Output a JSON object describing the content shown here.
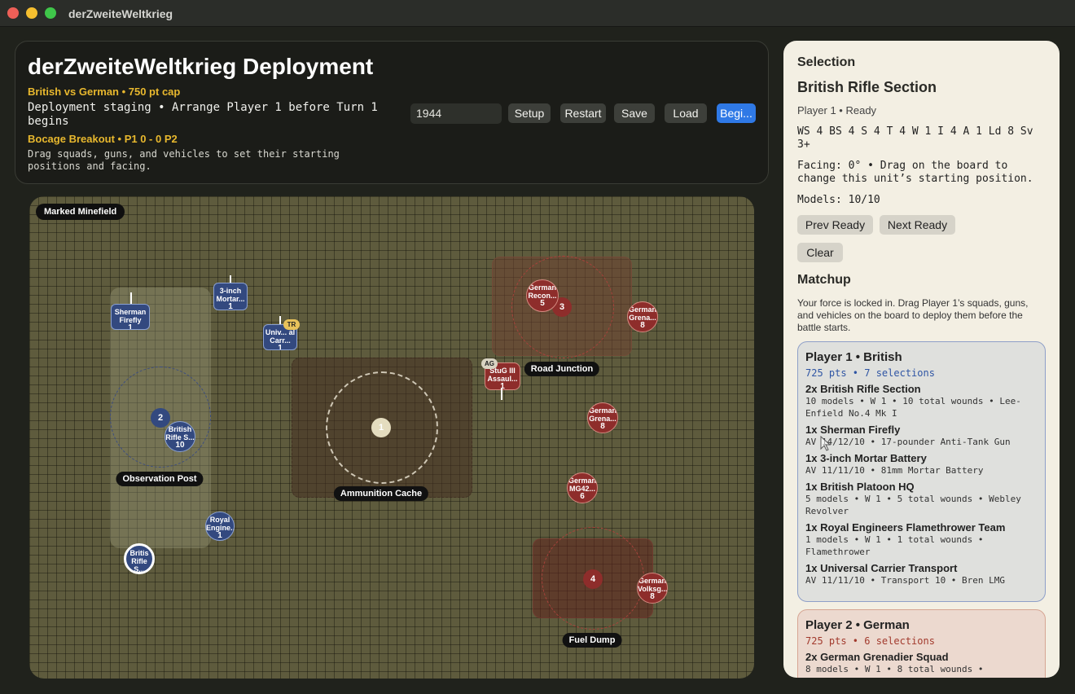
{
  "window": {
    "title": "derZweiteWeltkrieg"
  },
  "header": {
    "title": "derZweiteWeltkrieg Deployment",
    "subtitle": "British vs German • 750 pt cap",
    "status": "Deployment staging • Arrange Player 1 before Turn 1 begins",
    "scenario": "Bocage Breakout • P1 0 - 0 P2",
    "help": "Drag squads, guns, and vehicles to set their starting positions and facing.",
    "year_value": "1944",
    "buttons": {
      "setup": "Setup",
      "restart": "Restart",
      "save": "Save",
      "load": "Load",
      "begin": "Begi..."
    }
  },
  "board": {
    "minefield_label": "Marked Minefield",
    "objectives": [
      {
        "label": "Observation Post",
        "number": "2"
      },
      {
        "label": "Ammunition Cache",
        "number": "1"
      },
      {
        "label": "Road Junction",
        "number": "3"
      },
      {
        "label": "Fuel Dump",
        "number": "4"
      }
    ],
    "units": {
      "sherman": {
        "name": "Sherman Firefly",
        "count": "1"
      },
      "mortar": {
        "name": "3-inch Mortar...",
        "count": "1"
      },
      "carrier": {
        "name": "Univ... al Carr...",
        "count": "1",
        "badge": "TR"
      },
      "rifle_a": {
        "name": "British Rifle S...",
        "count": "10"
      },
      "rifle_b": {
        "name": "Britis Rifle S...",
        "count": "10"
      },
      "engineers": {
        "name": "Royal Engine...",
        "count": "1"
      },
      "recon": {
        "name": "German Recon...",
        "count": "5"
      },
      "gren_a": {
        "name": "German Grena...",
        "count": "8"
      },
      "stug": {
        "name": "StuG III Assaul...",
        "count": "1",
        "badge": "AG"
      },
      "gren_b": {
        "name": "German Grena...",
        "count": "8"
      },
      "mg42": {
        "name": "German MG42...",
        "count": "6"
      },
      "volks": {
        "name": "German Volksg...",
        "count": "8"
      }
    }
  },
  "panel": {
    "section_title": "Selection",
    "unit_name": "British Rifle Section",
    "unit_status": "Player 1 • Ready",
    "stats": "WS 4 BS 4 S 4 T 4 W 1 I 4 A 1 Ld 8 Sv 3+",
    "facing": "Facing: 0° • Drag on the board to change this unit’s starting position.",
    "models": "Models: 10/10",
    "buttons": {
      "prev": "Prev Ready",
      "next": "Next Ready",
      "clear": "Clear"
    },
    "matchup_title": "Matchup",
    "matchup_note": "Your force is locked in. Drag Player 1’s squads, guns, and vehicles on the board to deploy them before the battle starts.",
    "player1": {
      "title": "Player 1 • British",
      "points": "725 pts • 7 selections",
      "items": [
        {
          "name": "2x British Rifle Section",
          "detail": "10 models • W 1 • 10 total wounds • Lee-Enfield No.4 Mk I"
        },
        {
          "name": "1x Sherman Firefly",
          "detail": "AV 14/12/10 • 17-pounder Anti-Tank Gun"
        },
        {
          "name": "1x 3-inch Mortar Battery",
          "detail": "AV 11/11/10 • 81mm Mortar Battery"
        },
        {
          "name": "1x British Platoon HQ",
          "detail": "5 models • W 1 • 5 total wounds • Webley Revolver"
        },
        {
          "name": "1x Royal Engineers Flamethrower Team",
          "detail": "1 models • W 1 • 1 total wounds • Flamethrower"
        },
        {
          "name": "1x Universal Carrier Transport",
          "detail": "AV 11/11/10 • Transport 10 • Bren LMG"
        }
      ]
    },
    "player2": {
      "title": "Player 2 • German",
      "points": "725 pts • 6 selections",
      "items": [
        {
          "name": "2x German Grenadier Squad",
          "detail": "8 models • W 1 • 8 total wounds •"
        }
      ]
    }
  }
}
